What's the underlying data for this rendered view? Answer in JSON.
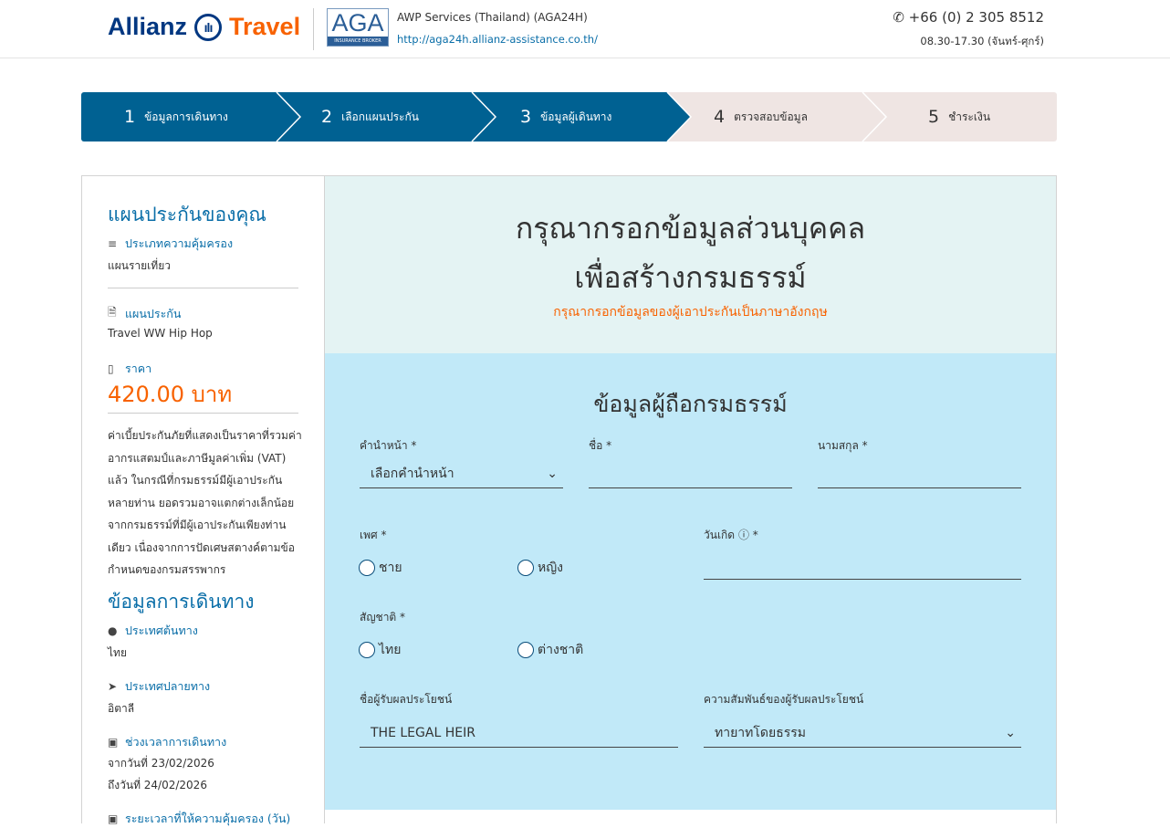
{
  "header": {
    "brand_left": "Allianz",
    "brand_mark": "ılı",
    "brand_right": "Travel",
    "aga_logo": "AGA",
    "aga_sub": "INSURANCE BROKER",
    "company": "AWP Services (Thailand) (AGA24H)",
    "url": "http://aga24h.allianz-assistance.co.th/",
    "phone": "+66 (0) 2 305 8512",
    "hours": "08.30-17.30 (จันทร์-ศุกร์)"
  },
  "steps": [
    {
      "num": "1",
      "label": "ข้อมูลการเดินทาง"
    },
    {
      "num": "2",
      "label": "เลือกแผนประกัน"
    },
    {
      "num": "3",
      "label": "ข้อมูลผู้เดินทาง"
    },
    {
      "num": "4",
      "label": "ตรวจสอบข้อมูล"
    },
    {
      "num": "5",
      "label": "ชำระเงิน"
    }
  ],
  "sidebar": {
    "plan_title": "แผนประกันของคุณ",
    "coverage_type_label": "ประเภทความคุ้มครอง",
    "coverage_type": "แผนรายเที่ยว",
    "plan_label": "แผนประกัน",
    "plan": "Travel WW Hip Hop",
    "price_label": "ราคา",
    "price": "420.00 บาท",
    "note": "ค่าเบี้ยประกันภัยที่แสดงเป็นราคาที่รวมค่าอากรแสตมป์และภาษีมูลค่าเพิ่ม (VAT) แล้ว ในกรณีที่กรมธรรม์มีผู้เอาประกันหลายท่าน ยอดรวมอาจแตกต่างเล็กน้อยจากกรมธรรม์ที่มีผู้เอาประกันเพียงท่านเดียว เนื่องจากการปัดเศษสตางค์ตามข้อกำหนดของกรมสรรพากร",
    "trip_title": "ข้อมูลการเดินทาง",
    "origin_label": "ประเทศต้นทาง",
    "origin": "ไทย",
    "dest_label": "ประเทศปลายทาง",
    "dest": "อิตาลี",
    "period_label": "ช่วงเวลาการเดินทาง",
    "from": "จากวันที่ 23/02/2026",
    "to": "ถึงวันที่ 24/02/2026",
    "duration_label": "ระยะเวลาที่ให้ความคุ้มครอง (วัน)"
  },
  "main": {
    "title1": "กรุณากรอกข้อมูลส่วนบุคคล",
    "title2": "เพื่อสร้างกรมธรรม์",
    "subtitle": "กรุณากรอกข้อมูลของผู้เอาประกันเป็นภาษาอังกฤษ",
    "form_title": "ข้อมูลผู้ถือกรมธรรม์",
    "prefix_label": "คำนำหน้า *",
    "prefix_value": "เลือกคำนำหน้า",
    "first_label": "ชื่อ *",
    "last_label": "นามสกุล *",
    "gender_label": "เพศ *",
    "male": "ชาย",
    "female": "หญิง",
    "dob_label": "วันเกิด",
    "dob_req": "*",
    "nat_label": "สัญชาติ *",
    "thai": "ไทย",
    "foreign": "ต่างชาติ",
    "ben_label": "ชื่อผู้รับผลประโยชน์",
    "ben_value": "THE LEGAL HEIR",
    "rel_label": "ความสัมพันธ์ของผู้รับผลประโยชน์",
    "rel_value": "ทายาทโดยธรรม"
  }
}
